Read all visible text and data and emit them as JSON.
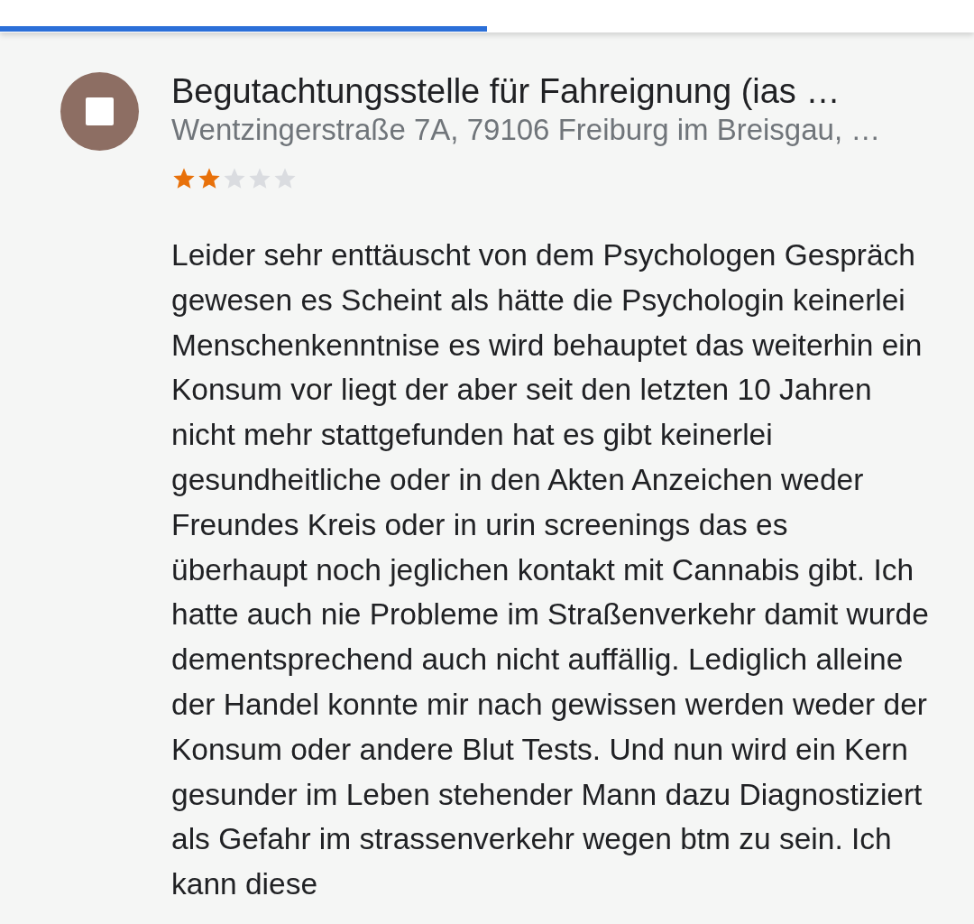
{
  "progress": {
    "level": 0.5
  },
  "place": {
    "title": "Begutachtungsstelle für Fahreignung (ias …",
    "address": "Wentzingerstraße 7A, 79106 Freiburg im Breisgau, …",
    "stars": 2
  },
  "review": {
    "text": "Leider sehr enttäuscht von dem Psychologen Gespräch gewesen es Scheint als hätte die Psychologin keinerlei Menschenkenntnise es wird behauptet das weiterhin ein Konsum vor liegt der aber seit den letzten 10 Jahren nicht mehr stattgefunden hat es gibt keinerlei gesundheitliche oder in den Akten Anzeichen weder Freundes Kreis oder in urin screenings das es überhaupt noch jeglichen kontakt mit Cannabis gibt. Ich hatte auch nie Probleme im Straßenverkehr damit wurde dementsprechend auch nicht auffällig. Lediglich alleine der Handel konnte mir nach gewissen werden weder der Konsum oder andere Blut Tests. Und nun wird ein Kern gesunder im Leben stehender Mann dazu Diagnostiziert als Gefahr im strassenverkehr wegen btm zu sein. Ich kann diese"
  }
}
